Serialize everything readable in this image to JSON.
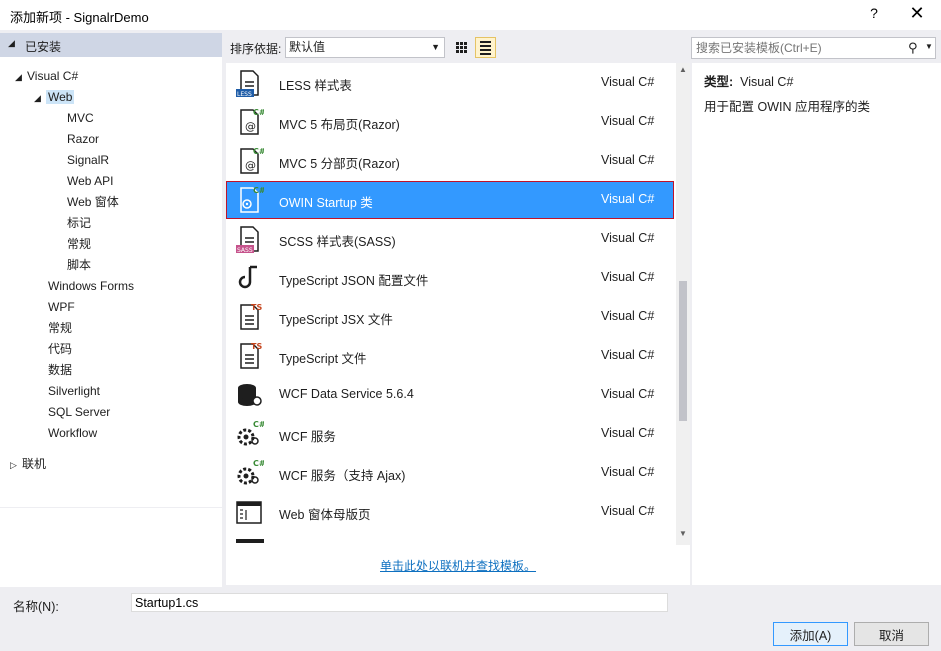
{
  "window": {
    "title": "添加新项 - SignalrDemo",
    "help": "?",
    "close": "✕"
  },
  "tree": {
    "header": "已安装",
    "nodes": [
      {
        "label": "Visual C#",
        "toggle": "◢"
      },
      {
        "label": "Web",
        "toggle": "◢"
      },
      {
        "label": "MVC"
      },
      {
        "label": "Razor"
      },
      {
        "label": "SignalR"
      },
      {
        "label": "Web API"
      },
      {
        "label": "Web 窗体"
      },
      {
        "label": "标记"
      },
      {
        "label": "常规"
      },
      {
        "label": "脚本"
      },
      {
        "label": "Windows Forms"
      },
      {
        "label": "WPF"
      },
      {
        "label": "常规"
      },
      {
        "label": "代码"
      },
      {
        "label": "数据"
      },
      {
        "label": "Silverlight"
      },
      {
        "label": "SQL Server"
      },
      {
        "label": "Workflow"
      },
      {
        "label": "联机",
        "toggle": "▷"
      }
    ]
  },
  "toolbar": {
    "sort_label": "排序依据:",
    "sort_value": "默认值",
    "search_placeholder": "搜索已安装模板(Ctrl+E)"
  },
  "templates": [
    {
      "name": "LESS 样式表",
      "lang": "Visual C#",
      "icon": "less-file-icon"
    },
    {
      "name": "MVC 5 布局页(Razor)",
      "lang": "Visual C#",
      "icon": "razor-layout-icon"
    },
    {
      "name": "MVC 5 分部页(Razor)",
      "lang": "Visual C#",
      "icon": "razor-partial-icon"
    },
    {
      "name": "OWIN Startup 类",
      "lang": "Visual C#",
      "icon": "owin-startup-icon",
      "selected": true
    },
    {
      "name": "SCSS 样式表(SASS)",
      "lang": "Visual C#",
      "icon": "sass-file-icon"
    },
    {
      "name": "TypeScript JSON 配置文件",
      "lang": "Visual C#",
      "icon": "ts-json-icon"
    },
    {
      "name": "TypeScript JSX 文件",
      "lang": "Visual C#",
      "icon": "tsx-file-icon"
    },
    {
      "name": "TypeScript 文件",
      "lang": "Visual C#",
      "icon": "ts-file-icon"
    },
    {
      "name": "WCF Data Service 5.6.4",
      "lang": "Visual C#",
      "icon": "data-service-icon"
    },
    {
      "name": "WCF 服务",
      "lang": "Visual C#",
      "icon": "wcf-service-icon"
    },
    {
      "name": "WCF 服务（支持 Ajax)",
      "lang": "Visual C#",
      "icon": "wcf-ajax-service-icon"
    },
    {
      "name": "Web 窗体母版页",
      "lang": "Visual C#",
      "icon": "master-page-icon"
    }
  ],
  "online_link": "单击此处以联机并查找模板。",
  "details": {
    "type_label": "类型:",
    "type_value": "Visual C#",
    "description": "用于配置 OWIN 应用程序的类"
  },
  "bottom": {
    "name_label": "名称",
    "name_label_suffix": "(N):",
    "name_value": "Startup1.cs",
    "add_button": "添加(A)",
    "cancel_button": "取消"
  },
  "colors": {
    "selection": "#3399ff",
    "selection_border": "#c0132a",
    "link": "#0e70c0",
    "tree_header": "#cfd6e5"
  }
}
